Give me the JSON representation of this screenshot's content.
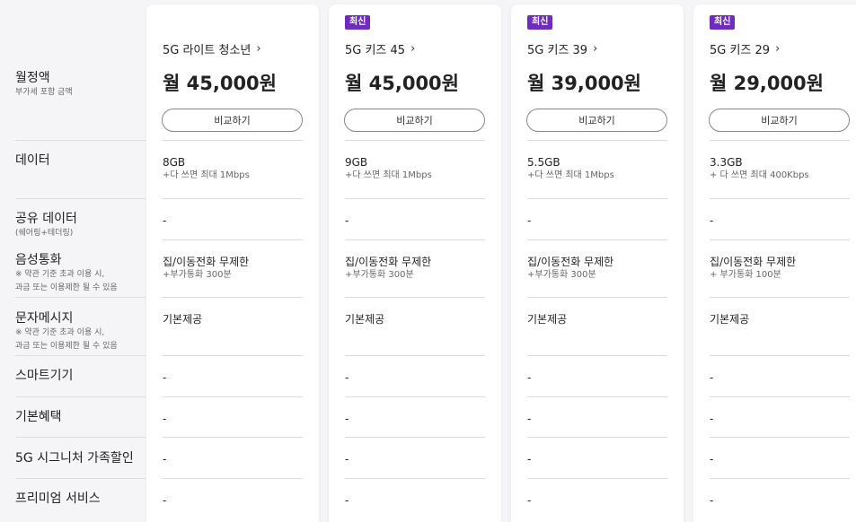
{
  "labels": {
    "monthly_fee": {
      "title": "월정액",
      "sub": "부가세 포함 금액"
    },
    "data": {
      "title": "데이터"
    },
    "shared_data": {
      "title": "공유 데이터",
      "sub": "(쉐어링+테더링)"
    },
    "voice": {
      "title": "음성통화",
      "sub1": "※ 약관 기준 초과 이용 시,",
      "sub2": "과금 또는 이용제한 될 수 있음"
    },
    "sms": {
      "title": "문자메시지",
      "sub1": "※ 약관 기준 초과 이용 시,",
      "sub2": "과금 또는 이용제한 될 수 있음"
    },
    "smart_device": {
      "title": "스마트기기"
    },
    "basic_benefit": {
      "title": "기본혜택"
    },
    "family_discount": {
      "title": "5G 시그니처 가족할인"
    },
    "premium": {
      "title": "프리미엄 서비스"
    }
  },
  "compare_label": "비교하기",
  "badge_label": "최신",
  "plans": [
    {
      "name": "5G 라이트 청소년",
      "has_badge": false,
      "price": "월 45,000원",
      "data_main": "8GB",
      "data_sub": "+다 쓰면 최대 1Mbps",
      "shared": "-",
      "voice_main": "집/이동전화 무제한",
      "voice_sub": "+부가통화 300분",
      "sms": "기본제공",
      "smart_device": "-",
      "basic_benefit": "-",
      "family_discount": "-",
      "premium": "-"
    },
    {
      "name": "5G 키즈 45",
      "has_badge": true,
      "price": "월 45,000원",
      "data_main": "9GB",
      "data_sub": "+다 쓰면 최대 1Mbps",
      "shared": "-",
      "voice_main": "집/이동전화 무제한",
      "voice_sub": "+부가통화 300분",
      "sms": "기본제공",
      "smart_device": "-",
      "basic_benefit": "-",
      "family_discount": "-",
      "premium": "-"
    },
    {
      "name": "5G 키즈 39",
      "has_badge": true,
      "price": "월 39,000원",
      "data_main": "5.5GB",
      "data_sub": "+다 쓰면 최대 1Mbps",
      "shared": "-",
      "voice_main": "집/이동전화 무제한",
      "voice_sub": "+부가통화 300분",
      "sms": "기본제공",
      "smart_device": "-",
      "basic_benefit": "-",
      "family_discount": "-",
      "premium": "-"
    },
    {
      "name": "5G 키즈 29",
      "has_badge": true,
      "price": "월 29,000원",
      "data_main": "3.3GB",
      "data_sub": "+ 다 쓰면 최대 400Kbps",
      "shared": "-",
      "voice_main": "집/이동전화 무제한",
      "voice_sub": "+ 부가통화 100분",
      "sms": "기본제공",
      "smart_device": "-",
      "basic_benefit": "-",
      "family_discount": "-",
      "premium": "-"
    }
  ],
  "colors": {
    "badge": "#6f2dbd",
    "divider": "#dcdcdc",
    "page_bg": "#f5f5f7"
  },
  "icons": {
    "plan_link": "chevron-right-icon"
  }
}
